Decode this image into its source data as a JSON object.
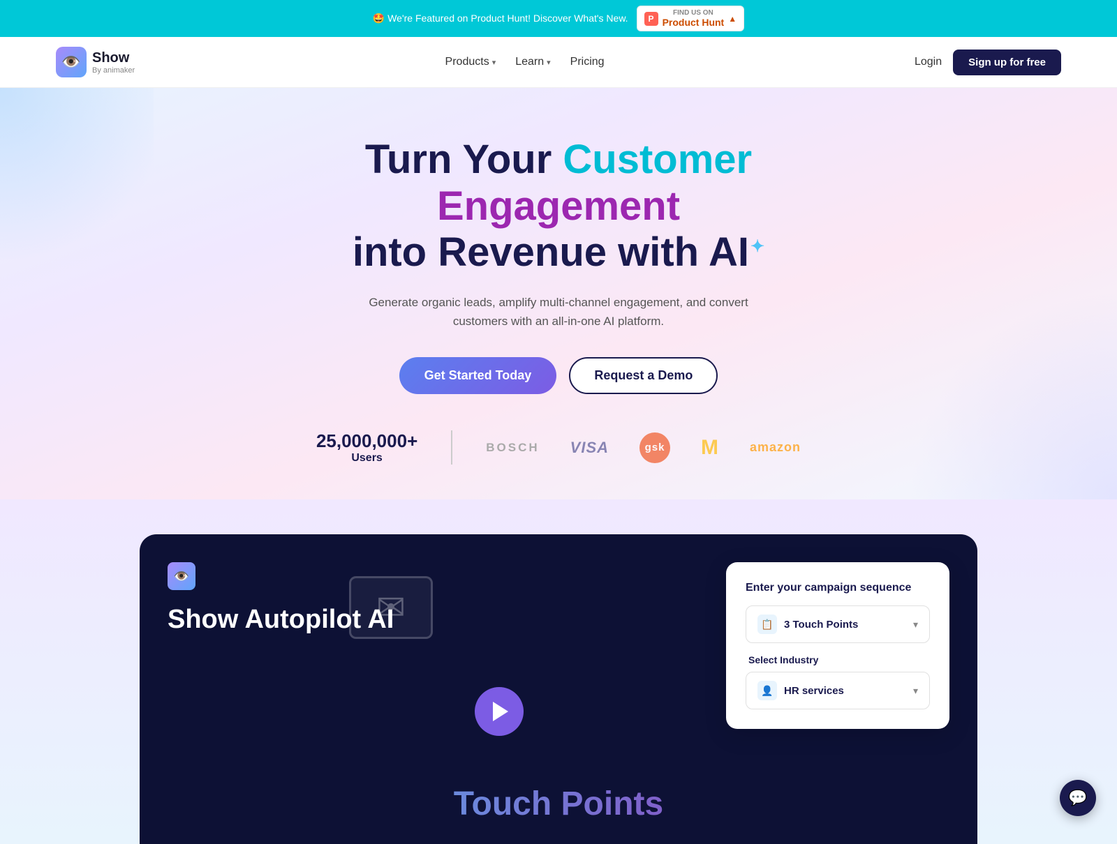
{
  "banner": {
    "text": "🤩 We're Featured on Product Hunt! Discover What's New.",
    "badge_label": "Product Hunt",
    "badge_sub": "FIND US ON"
  },
  "nav": {
    "logo_name": "Show",
    "logo_sub": "By animaker",
    "links": [
      {
        "label": "Products",
        "has_dropdown": true
      },
      {
        "label": "Learn",
        "has_dropdown": true
      },
      {
        "label": "Pricing",
        "has_dropdown": false
      }
    ],
    "login": "Login",
    "signup": "Sign up for free"
  },
  "hero": {
    "headline_part1": "Turn Your ",
    "headline_customer": "Customer",
    "headline_engagement": "Engagement",
    "headline_part2": "into Revenue with AI",
    "subtext": "Generate organic leads, amplify multi-channel engagement, and convert customers with an all-in-one AI platform.",
    "cta_primary": "Get Started Today",
    "cta_secondary": "Request a Demo",
    "users_count": "25,000,000+",
    "users_label": "Users",
    "brands": [
      "BOSCH",
      "VISA",
      "gsk",
      "M",
      "amazon"
    ]
  },
  "dark_section": {
    "title": "Show Autopilot AI",
    "campaign_card": {
      "title": "Enter your campaign sequence",
      "touch_points_label": "3 Touch Points",
      "touch_points_icon": "📋",
      "industry_label": "Select Industry",
      "industry_value": "HR services",
      "industry_icon": "👤"
    }
  },
  "footer_section": {
    "touch_points_text": "Touch Points"
  },
  "chat": {
    "icon": "💬"
  }
}
